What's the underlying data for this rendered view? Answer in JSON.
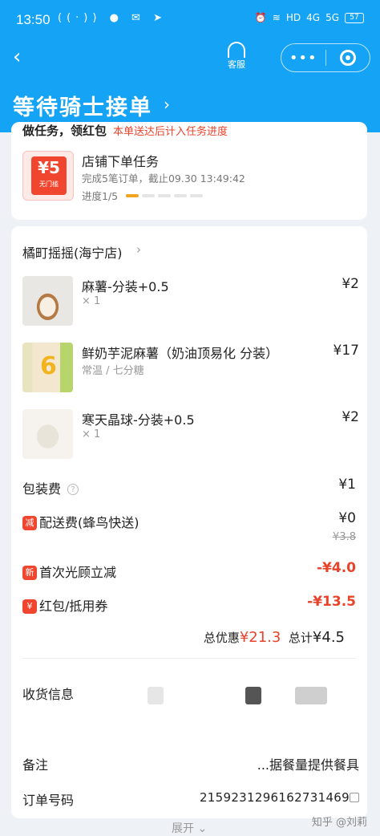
{
  "status_bar": {
    "time": "13:50",
    "left_icons": [
      "signal-wave-icon",
      "wechat-icon",
      "mail-icon",
      "send-icon"
    ],
    "right_icons": [
      "alarm-icon",
      "vibrate-icon",
      "hd-icon",
      "signal-4g-icon",
      "signal-5g-icon"
    ],
    "signal_4g": "4G",
    "signal_5g": "5G",
    "hd": "HD",
    "battery": "57"
  },
  "nav": {
    "service_label": "客服",
    "title": "等待骑士接单"
  },
  "task_card": {
    "heading": "做任务，领红包",
    "heading_note": "本单送达后计入任务进度",
    "coupon_amount": "¥5",
    "coupon_label": "无门槛",
    "task_title": "店铺下单任务",
    "task_desc": "完成5笔订单，截止09.30 13:49:42",
    "progress_text": "进度1/5",
    "progress": {
      "done": 1,
      "total": 5
    }
  },
  "order": {
    "shop_name": "橘町摇摇(海宁店)",
    "items": [
      {
        "name": "麻薯-分装+0.5",
        "spec": "× 1",
        "price": "¥2"
      },
      {
        "name": "鲜奶芋泥麻薯（奶油顶易化 分装）",
        "spec": "常温 / 七分糖",
        "price": "¥17"
      },
      {
        "name": "寒天晶球-分装+0.5",
        "spec": "× 1",
        "price": "¥2"
      }
    ],
    "packing_fee_label": "包装费",
    "packing_fee": "¥1",
    "delivery_tag": "减",
    "delivery_label": "配送费(蜂鸟快送)",
    "delivery_fee": "¥0",
    "delivery_original": "¥3.8",
    "new_tag": "新",
    "new_discount_label": "首次光顾立减",
    "new_discount": "-¥4.0",
    "redpack_tag": "¥",
    "redpack_label": "红包/抵用券",
    "redpack_discount": "-¥13.5",
    "total_discount_label": "总优惠",
    "total_discount": "¥21.3",
    "total_label": "总计",
    "total": "¥4.5"
  },
  "info": {
    "address_label": "收货信息",
    "remark_label": "备注",
    "remark_value": "...据餐量提供餐具",
    "order_no_label": "订单号码",
    "order_no": "2159231296162731469",
    "expand_label": "展开"
  },
  "watermark": "知乎 @刘莉",
  "colors": {
    "header": "#14a3f5",
    "accent_red": "#e8432b",
    "progress": "#f2a41e"
  }
}
